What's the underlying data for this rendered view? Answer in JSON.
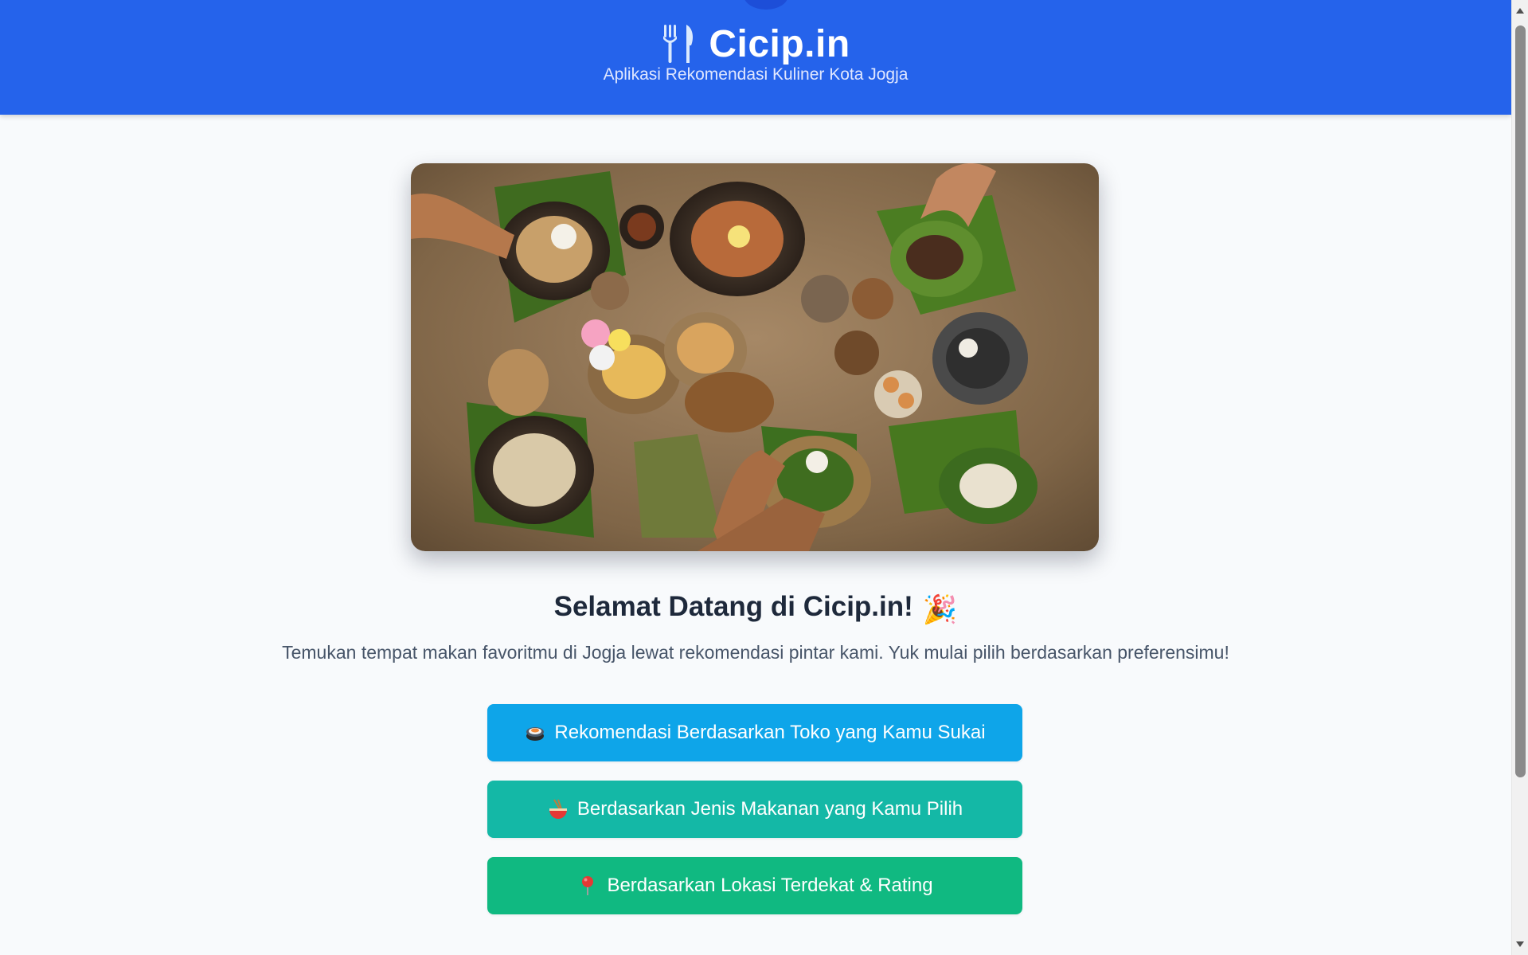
{
  "header": {
    "title": "Cicip.in",
    "subtitle": "Aplikasi Rekomendasi Kuliner Kota Jogja",
    "icon": "fork-knife-icon",
    "background_color": "#2563eb"
  },
  "hero": {
    "image": "indonesian-food-spread-photo"
  },
  "welcome": {
    "title": "Selamat Datang di Cicip.in!",
    "title_emoji": "🎉",
    "description": "Temukan tempat makan favoritmu di Jogja lewat rekomendasi pintar kami. Yuk mulai pilih berdasarkan preferensimu!"
  },
  "actions": [
    {
      "label": "Rekomendasi Berdasarkan Toko yang Kamu Sukai",
      "icon": "sushi-icon",
      "color": "#0ea5e9"
    },
    {
      "label": "Berdasarkan Jenis Makanan yang Kamu Pilih",
      "icon": "noodle-bowl-icon",
      "color": "#14b8a6"
    },
    {
      "label": "Berdasarkan Lokasi Terdekat & Rating",
      "icon": "pin-icon",
      "color": "#10b981"
    }
  ]
}
